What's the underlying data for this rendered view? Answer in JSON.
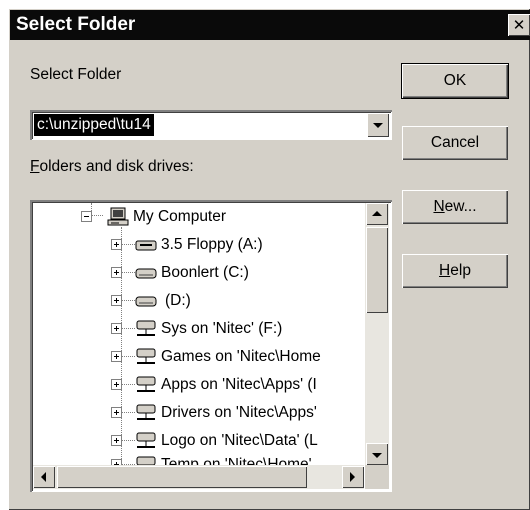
{
  "window": {
    "title": "Select Folder",
    "close_glyph": "✕"
  },
  "select_folder": {
    "label": "Select Folder",
    "value": "c:\\unzipped\\tu14"
  },
  "folders": {
    "label_mnemonic": "F",
    "label_rest": "olders and disk drives:",
    "items": [
      {
        "label": "My Computer",
        "icon": "computer-icon",
        "expander": "minus"
      },
      {
        "label": "3.5 Floppy (A:)",
        "icon": "floppy-drive-icon",
        "expander": "plus"
      },
      {
        "label": "Boonlert (C:)",
        "icon": "hard-drive-icon",
        "expander": "plus"
      },
      {
        "label": "(D:)",
        "icon": "hard-drive-icon",
        "expander": "plus"
      },
      {
        "label": "Sys on 'Nitec' (F:)",
        "icon": "network-drive-icon",
        "expander": "plus"
      },
      {
        "label": "Games on 'Nitec\\Home",
        "icon": "network-drive-icon",
        "expander": "plus"
      },
      {
        "label": "Apps on 'Nitec\\Apps' (I",
        "icon": "network-drive-icon",
        "expander": "plus"
      },
      {
        "label": "Drivers on 'Nitec\\Apps'",
        "icon": "network-drive-icon",
        "expander": "plus"
      },
      {
        "label": "Logo on 'Nitec\\Data' (L",
        "icon": "network-drive-icon",
        "expander": "plus"
      },
      {
        "label": "Temp on 'Nitec\\Home'",
        "icon": "network-drive-icon",
        "expander": "plus"
      }
    ]
  },
  "buttons": {
    "ok": "OK",
    "cancel": "Cancel",
    "new_mnemonic": "N",
    "new_rest": "ew...",
    "help_mnemonic": "H",
    "help_rest": "elp"
  },
  "colors": {
    "dialog_face": "#d4d0c8",
    "title_bar": "#0a0a0a",
    "selection": "#000000"
  }
}
